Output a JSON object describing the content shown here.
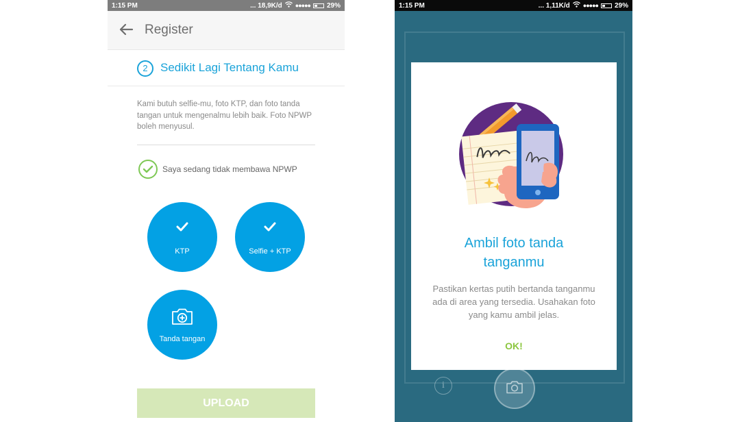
{
  "left_screen": {
    "status": {
      "time": "1:15 PM",
      "network": "... 18,9K/d",
      "signal": "●●●●●",
      "battery": "29%"
    },
    "appbar": {
      "title": "Register"
    },
    "step": {
      "number": "2",
      "title": "Sedikit Lagi Tentang Kamu"
    },
    "description": "Kami butuh selfie-mu, foto KTP, dan foto tanda tangan untuk mengenalmu lebih baik. Foto NPWP boleh menyusul.",
    "npwp_option": {
      "label": "Saya sedang tidak membawa NPWP",
      "checked": true
    },
    "documents": [
      {
        "label": "KTP",
        "state": "done"
      },
      {
        "label": "Selfie + KTP",
        "state": "done"
      },
      {
        "label": "Tanda tangan",
        "state": "pending"
      }
    ],
    "upload_label": "UPLOAD"
  },
  "right_screen": {
    "status": {
      "time": "1:15 PM",
      "network": "... 1,11K/d",
      "signal": "●●●●●",
      "battery": "29%"
    },
    "dialog": {
      "title_line1": "Ambil foto tanda",
      "title_line2": "tanganmu",
      "text": "Pastikan kertas putih bertanda tanganmu ada di area yang tersedia. Usahakan foto yang kamu ambil jelas.",
      "ok_label": "OK!"
    },
    "info_icon": "info-icon",
    "camera_icon": "camera-icon"
  },
  "colors": {
    "accent": "#03a1e4",
    "success": "#7ec855",
    "upload_disabled": "#d6e8b8",
    "camera_background": "#26667d"
  }
}
